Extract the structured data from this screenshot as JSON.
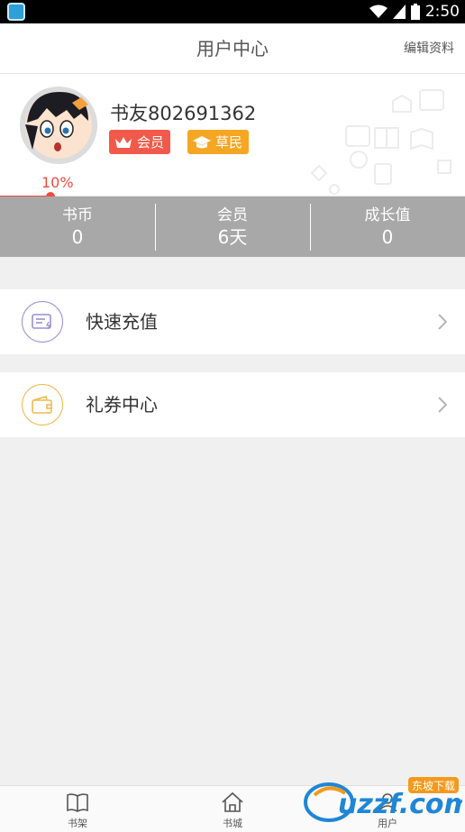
{
  "status_bar": {
    "time": "2:50"
  },
  "header": {
    "title": "用户中心",
    "edit_link": "编辑资料"
  },
  "profile": {
    "username": "书友802691362",
    "badges": [
      {
        "label": "会员",
        "icon": "crown-icon",
        "color": "#f15a4a"
      },
      {
        "label": "草民",
        "icon": "graduation-cap-icon",
        "color": "#f5a623"
      }
    ],
    "progress": {
      "label": "10%",
      "value": 0.1
    }
  },
  "stats": [
    {
      "label": "书币",
      "value": "0"
    },
    {
      "label": "会员",
      "value": "6天"
    },
    {
      "label": "成长值",
      "value": "0"
    }
  ],
  "menu": [
    {
      "label": "快速充值",
      "icon": "recharge-card-icon",
      "color": "#9a8fd0"
    },
    {
      "label": "礼券中心",
      "icon": "wallet-icon",
      "color": "#f0b94a"
    }
  ],
  "bottom_nav": [
    {
      "label": "书架",
      "icon": "book-icon"
    },
    {
      "label": "书城",
      "icon": "home-icon"
    },
    {
      "label": "用户",
      "icon": "user-icon"
    }
  ],
  "watermark": {
    "text": "uzzf.com",
    "tag": "东坡下载"
  },
  "colors": {
    "accent_red": "#ef4b3f",
    "stats_bg": "#a8a8a8"
  }
}
